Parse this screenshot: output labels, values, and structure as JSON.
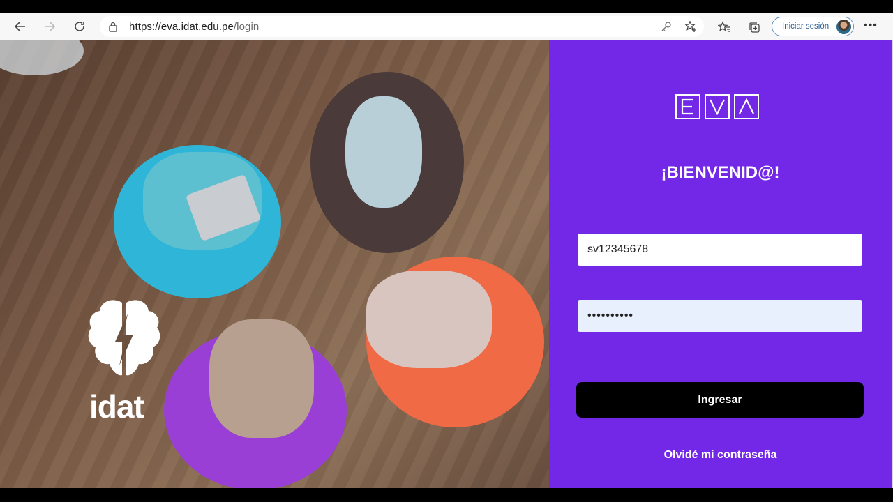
{
  "browser": {
    "url_host": "https://eva.idat.edu.pe",
    "url_path": "/login",
    "signin_label": "Iniciar sesión",
    "icons": [
      "back-icon",
      "forward-icon",
      "refresh-icon",
      "lock-icon",
      "key-icon",
      "add-favorite-icon",
      "favorites-icon",
      "collections-icon",
      "more-icon"
    ]
  },
  "brand": {
    "logo_text": "idat",
    "eva_letters": [
      "E",
      "V",
      "A"
    ]
  },
  "login": {
    "welcome": "¡BIENVENID@!",
    "username_value": "sv12345678",
    "password_value": "••••••••••",
    "submit_label": "Ingresar",
    "forgot_label": "Olvidé mi contraseña"
  },
  "colors": {
    "panel": "#7328e8",
    "button": "#000000",
    "password_fill": "#e8f0fe"
  }
}
